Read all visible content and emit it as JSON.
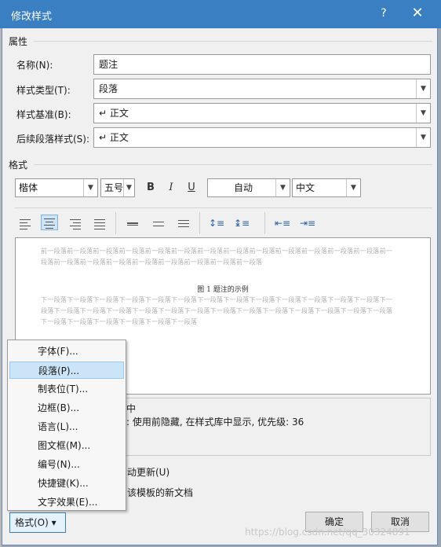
{
  "window": {
    "title": "修改样式",
    "help": "?",
    "close": "✕"
  },
  "properties": {
    "section": "属性",
    "name_label": "名称(N):",
    "name_value": "题注",
    "type_label": "样式类型(T):",
    "type_value": "段落",
    "based_label": "样式基准(B):",
    "based_value": "↵ 正文",
    "next_label": "后续段落样式(S):",
    "next_value": "↵ 正文"
  },
  "format": {
    "section": "格式",
    "font": "楷体",
    "size": "五号",
    "bold": "B",
    "italic": "I",
    "underline": "U",
    "color": "自动",
    "script": "中文"
  },
  "preview": {
    "prev_text": "前一段落前一段落前一段落前一段落前一段落前一段落前一段落前一段落前一段落前一段落前一段落前一段落前一段落前一段落前一段落前一段落前一段落前一段落前一段落前一段落前一段落前一段落",
    "caption": "图 1  题注的示例",
    "next_text": "下一段落下一段落下一段落下一段落下一段落下一段落下一段落下一段落下一段落下一段落下一段落下一段落下一段落下一段落下一段落下一段落下一段落下一段落下一段落下一段落下一段落下一段落下一段落下一段落下一段落下一段落下一段落下一段落下一段落下一段落下一段落下一段落下一段落"
  },
  "description": {
    "line1": "中",
    "line2": ": 使用前隐藏, 在样式库中显示, 优先级: 36"
  },
  "menu": {
    "items": [
      "字体(F)...",
      "段落(P)...",
      "制表位(T)...",
      "边框(B)...",
      "语言(L)...",
      "图文框(M)...",
      "编号(N)...",
      "快捷键(K)...",
      "文字效果(E)..."
    ],
    "highlighted": "段落(P)..."
  },
  "options": {
    "auto_update": "动更新(U)",
    "template": "该模板的新文档"
  },
  "buttons": {
    "format": "格式(O) ▾",
    "ok": "确定",
    "cancel": "取消"
  },
  "watermark": "https://blog.csdn.net/qq_30324891"
}
